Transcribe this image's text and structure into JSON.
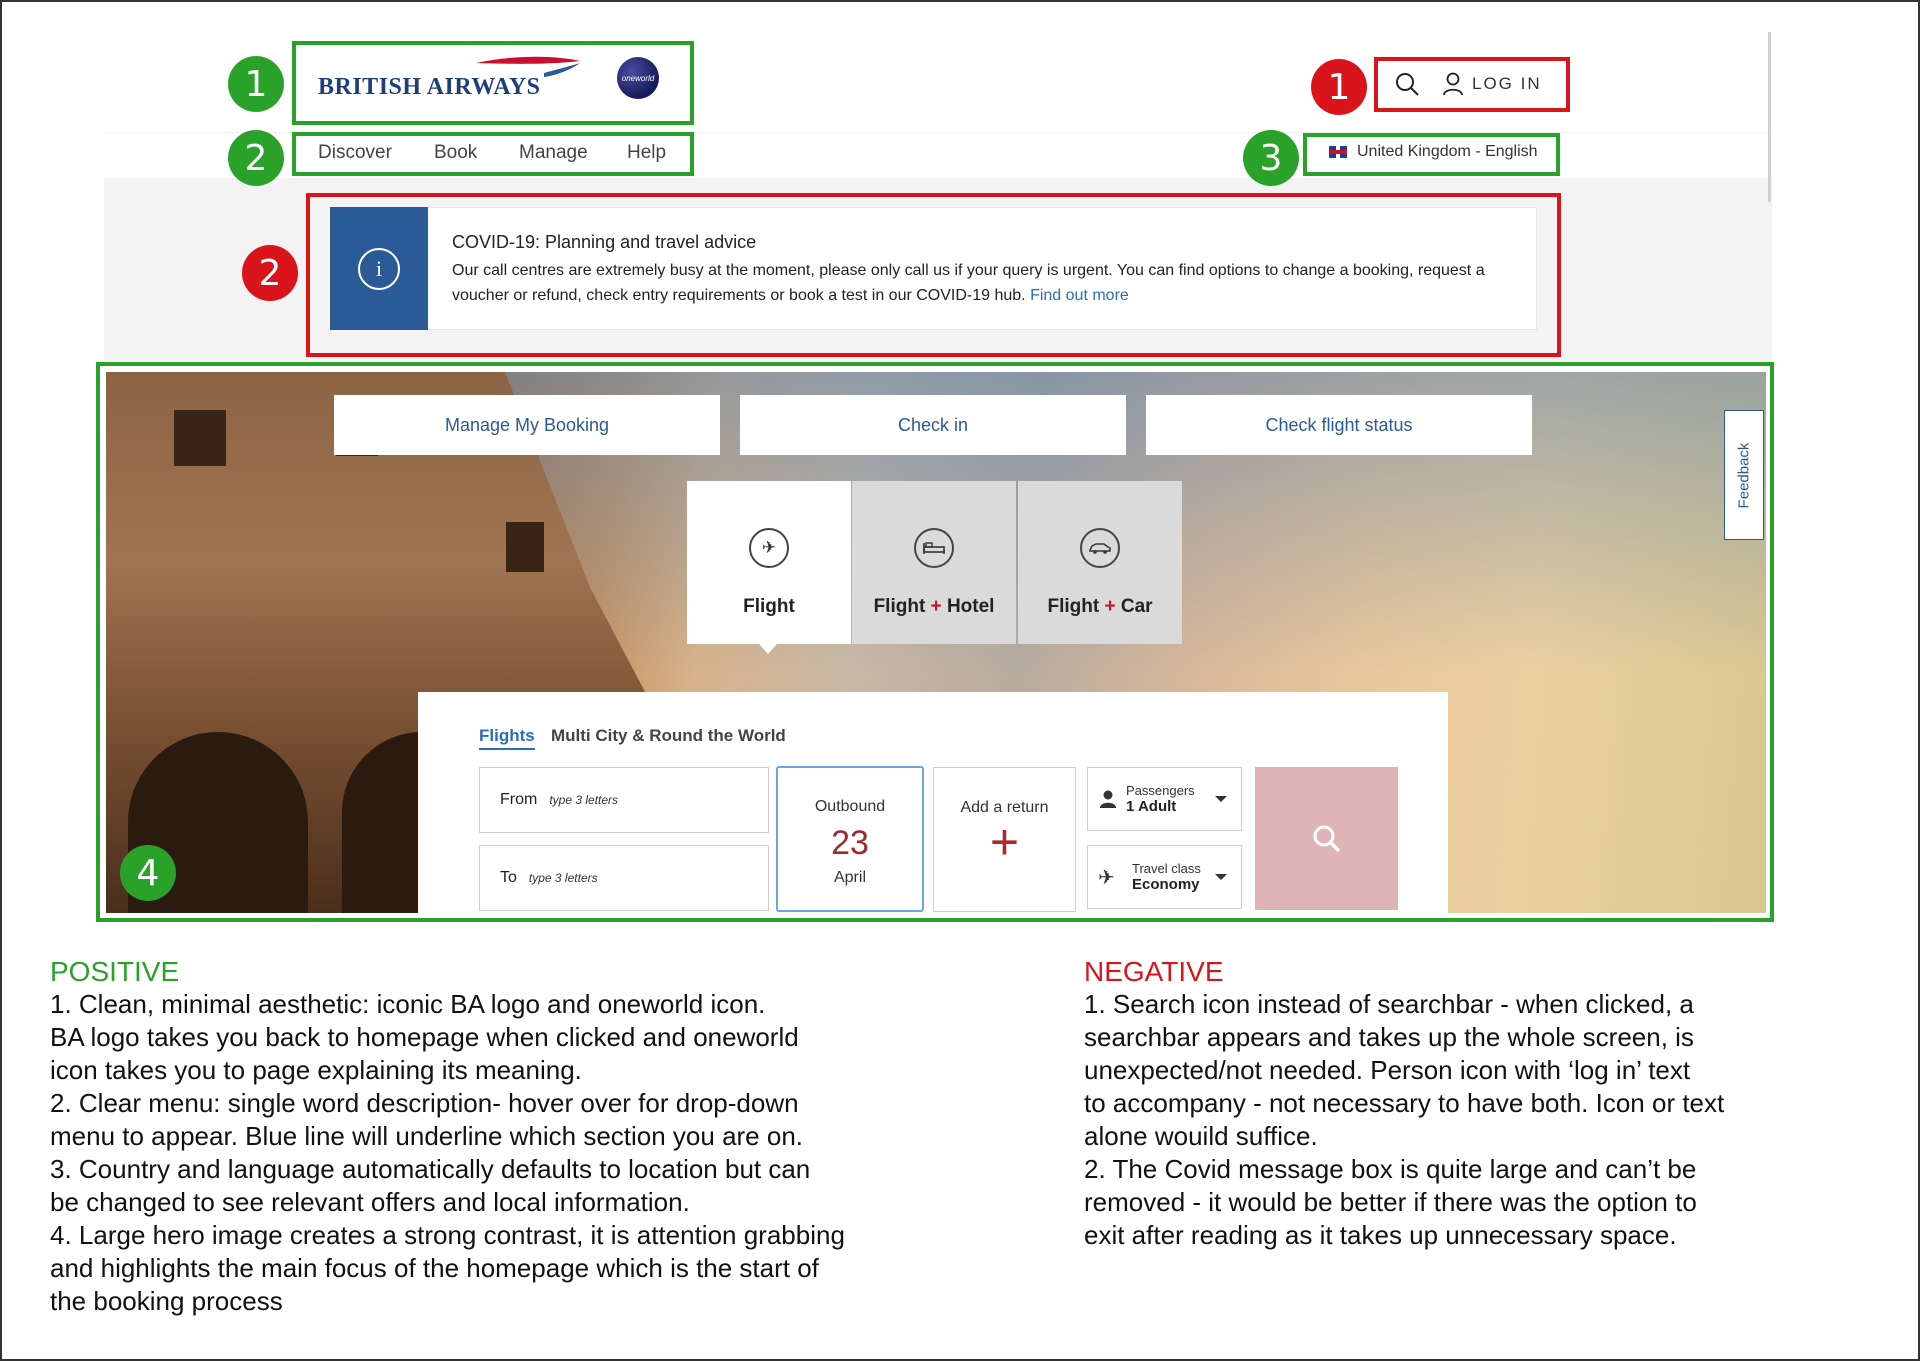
{
  "header": {
    "logo_text": "BRITISH AIRWAYS",
    "oneworld_text": "oneworld",
    "login_label": "LOG IN",
    "locale_label": "United Kingdom - English"
  },
  "nav": {
    "items": [
      "Discover",
      "Book",
      "Manage",
      "Help"
    ]
  },
  "covid": {
    "title": "COVID-19: Planning and travel advice",
    "body": "Our call centres are extremely busy at the moment, please only call us if your query is urgent. You can find options to change a booking, request a voucher or refund, check entry requirements or book a test in our COVID-19 hub.",
    "link": "Find out more",
    "icon_char": "i"
  },
  "quick_actions": [
    "Manage My Booking",
    "Check in",
    "Check flight status"
  ],
  "feedback_label": "Feedback",
  "product_tabs": [
    {
      "label": "Flight",
      "icon": "plane-icon"
    },
    {
      "label_a": "Flight",
      "plus": "+",
      "label_b": "Hotel",
      "icon": "bed-icon"
    },
    {
      "label_a": "Flight",
      "plus": "+",
      "label_b": "Car",
      "icon": "car-icon"
    }
  ],
  "widget": {
    "tabs": [
      "Flights",
      "Multi City & Round the World"
    ],
    "from_label": "From",
    "from_placeholder": "type 3 letters",
    "to_label": "To",
    "to_placeholder": "type 3 letters",
    "outbound_label": "Outbound",
    "outbound_day": "23",
    "outbound_month": "April",
    "return_label": "Add a return",
    "return_plus": "+",
    "passengers_label": "Passengers",
    "passengers_value": "1 Adult",
    "class_label": "Travel class",
    "class_value": "Economy"
  },
  "badges": {
    "logo": "1",
    "tools": "1",
    "nav": "2",
    "covid": "2",
    "locale": "3",
    "hero": "4"
  },
  "notes": {
    "positive_title": "POSITIVE",
    "positive_lines": [
      "1. Clean, minimal aesthetic: iconic BA logo and oneworld icon.",
      "BA logo takes you back to homepage when clicked and oneworld",
      "icon takes you to page explaining its meaning.",
      "2. Clear menu: single word description- hover over for drop-down",
      "menu to appear. Blue line will underline which section you are on.",
      "3. Country and language automatically defaults to location but can",
      "be changed to see relevant offers and local information.",
      "4. Large hero image creates a strong contrast, it is attention grabbing",
      "and highlights the main focus of the homepage which is the start of",
      "the booking process"
    ],
    "negative_title": "NEGATIVE",
    "negative_lines": [
      "1. Search icon instead of searchbar - when clicked, a",
      "searchbar appears and takes up the whole screen, is",
      "unexpected/not needed. Person icon with ‘log in’ text",
      "to accompany - not necessary to have both. Icon or text",
      "alone wouild suffice.",
      "2. The Covid message box is quite large and can’t be",
      "removed - it would be better if there was the option to",
      "exit after reading as it takes up unnecessary space."
    ]
  },
  "colors": {
    "ba_blue": "#1e3f7a",
    "link_blue": "#2a6ebb",
    "accent_red": "#c8102e",
    "positive_green": "#2aa22a",
    "negative_red": "#d9141b",
    "search_pink": "#dfb4b6"
  }
}
